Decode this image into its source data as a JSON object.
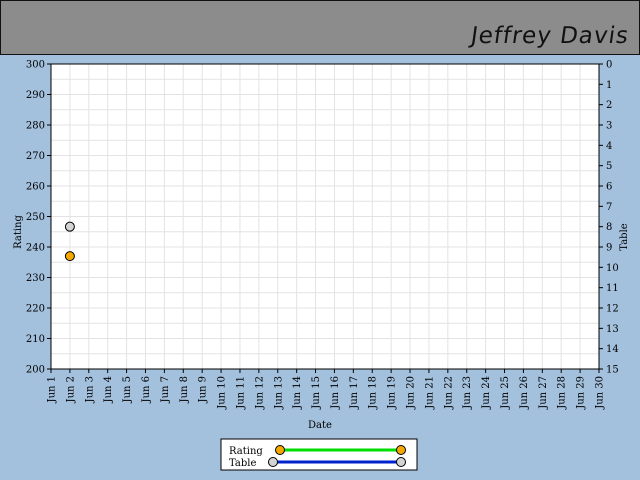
{
  "header": {
    "player_name": "Jeffrey Davis"
  },
  "chart_data": {
    "type": "scatter",
    "title": "",
    "xlabel": "Date",
    "ylabel": "Rating",
    "y2label": "Table",
    "x_ticks": [
      "Jun 1",
      "Jun 2",
      "Jun 3",
      "Jun 4",
      "Jun 5",
      "Jun 6",
      "Jun 7",
      "Jun 8",
      "Jun 9",
      "Jun 10",
      "Jun 11",
      "Jun 12",
      "Jun 13",
      "Jun 14",
      "Jun 15",
      "Jun 16",
      "Jun 17",
      "Jun 18",
      "Jun 19",
      "Jun 20",
      "Jun 21",
      "Jun 22",
      "Jun 23",
      "Jun 24",
      "Jun 25",
      "Jun 26",
      "Jun 27",
      "Jun 28",
      "Jun 29",
      "Jun 30"
    ],
    "ylim": [
      200,
      300
    ],
    "y_ticks": [
      200,
      210,
      220,
      230,
      240,
      250,
      260,
      270,
      280,
      290,
      300
    ],
    "y2lim": [
      0,
      15
    ],
    "y2_inverted": true,
    "y2_ticks": [
      0,
      1,
      2,
      3,
      4,
      5,
      6,
      7,
      8,
      9,
      10,
      11,
      12,
      13,
      14,
      15
    ],
    "grid": true,
    "legend_position": "bottom-center",
    "series": [
      {
        "name": "Rating",
        "axis": "left",
        "marker_color": "#f5a800",
        "line_color": "#00dd00",
        "points": [
          {
            "x": "Jun 2",
            "y": 237
          }
        ]
      },
      {
        "name": "Table",
        "axis": "right",
        "marker_color": "#d4d4d4",
        "line_color": "#0022cc",
        "points": [
          {
            "x": "Jun 2",
            "y": 8
          }
        ]
      }
    ]
  }
}
